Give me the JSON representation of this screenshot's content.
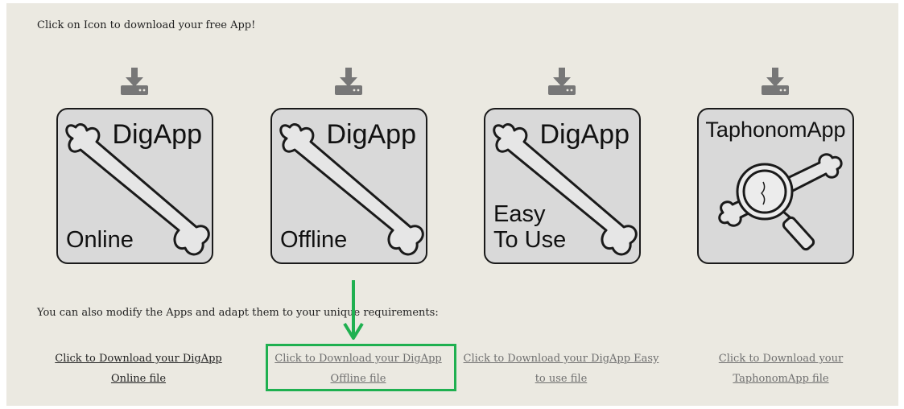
{
  "intro_text": "Click on Icon to download your free App!",
  "apps": [
    {
      "title": "DigApp",
      "subtitle": "Online",
      "link": "Click to Download your DigApp Online file"
    },
    {
      "title": "DigApp",
      "subtitle": "Offline",
      "link": "Click to Download your DigApp Offline file"
    },
    {
      "title": "DigApp",
      "subtitle": "Easy To Use",
      "subtitle_line1": "Easy",
      "subtitle_line2": "To Use",
      "link": "Click to Download your DigApp Easy to use file"
    },
    {
      "title": "TaphonomApp",
      "subtitle": "",
      "link": "Click to Download your TaphonomApp file"
    }
  ],
  "modify_text": "You can also modify the Apps and adapt them to your unique requirements:",
  "colors": {
    "background": "#ebe9e1",
    "tile": "#d9d9d9",
    "highlight": "#1fb050",
    "download_icon": "#777777"
  },
  "icons": [
    "download-icon",
    "bone-icon",
    "magnifier-icon",
    "arrow-down-icon"
  ]
}
